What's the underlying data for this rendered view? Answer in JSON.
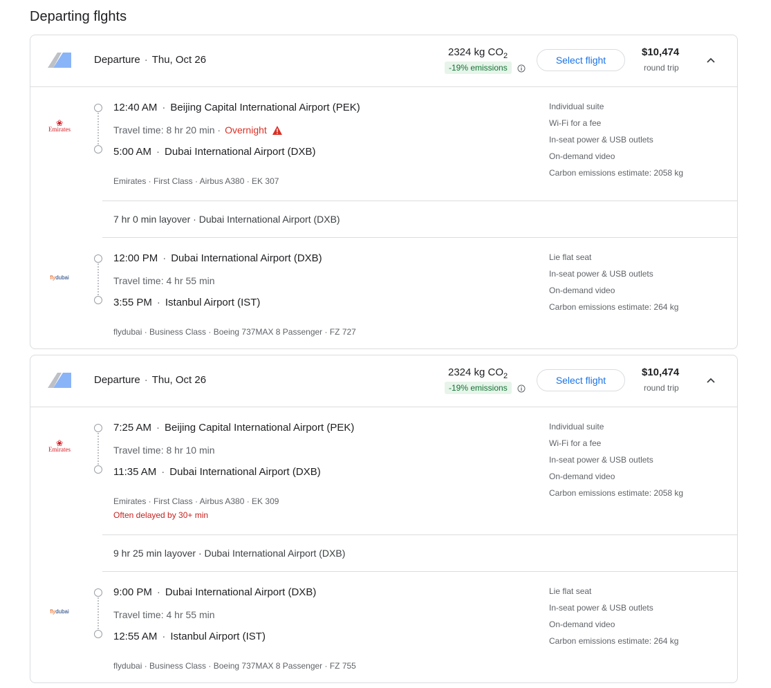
{
  "page_title": "Departing flghts",
  "colors": {
    "accent": "#1a73e8",
    "emissions_bg": "#e6f4ea",
    "emissions_text": "#137333",
    "warning": "#d93025",
    "border": "#dadce0"
  },
  "flights": [
    {
      "header": {
        "label": "Departure",
        "date": "Thu, Oct 26",
        "co2_value": "2324 kg CO",
        "co2_sub": "2",
        "emissions": "-19% emissions",
        "select_label": "Select flight",
        "price": "$10,474",
        "price_sub": "round trip"
      },
      "segments": [
        {
          "airline_logo": "Emirates",
          "dep_time": "12:40 AM",
          "dep_airport": "Beijing Capital International Airport (PEK)",
          "travel_time": "Travel time: 8 hr 20 min",
          "overnight": "Overnight",
          "arr_time": "5:00 AM",
          "arr_airport": "Dubai International Airport (DXB)",
          "details": "Emirates · First Class · Airbus A380 · EK 307",
          "delay": "",
          "amenities": [
            "Individual suite",
            "Wi-Fi for a fee",
            "In-seat power & USB outlets",
            "On-demand video",
            "Carbon emissions estimate: 2058 kg"
          ]
        },
        {
          "airline_logo": "flydubai",
          "dep_time": "12:00 PM",
          "dep_airport": "Dubai International Airport (DXB)",
          "travel_time": "Travel time: 4 hr 55 min",
          "overnight": "",
          "arr_time": "3:55 PM",
          "arr_airport": "Istanbul Airport (IST)",
          "details": "flydubai · Business Class · Boeing 737MAX 8 Passenger · FZ 727",
          "delay": "",
          "amenities": [
            "Lie flat seat",
            "In-seat power & USB outlets",
            "On-demand video",
            "Carbon emissions estimate: 264 kg"
          ]
        }
      ],
      "layover": "7 hr 0 min layover · Dubai International Airport (DXB)"
    },
    {
      "header": {
        "label": "Departure",
        "date": "Thu, Oct 26",
        "co2_value": "2324 kg CO",
        "co2_sub": "2",
        "emissions": "-19% emissions",
        "select_label": "Select flight",
        "price": "$10,474",
        "price_sub": "round trip"
      },
      "segments": [
        {
          "airline_logo": "Emirates",
          "dep_time": "7:25 AM",
          "dep_airport": "Beijing Capital International Airport (PEK)",
          "travel_time": "Travel time: 8 hr 10 min",
          "overnight": "",
          "arr_time": "11:35 AM",
          "arr_airport": "Dubai International Airport (DXB)",
          "details": "Emirates · First Class · Airbus A380 · EK 309",
          "delay": "Often delayed by 30+ min",
          "amenities": [
            "Individual suite",
            "Wi-Fi for a fee",
            "In-seat power & USB outlets",
            "On-demand video",
            "Carbon emissions estimate: 2058 kg"
          ]
        },
        {
          "airline_logo": "flydubai",
          "dep_time": "9:00 PM",
          "dep_airport": "Dubai International Airport (DXB)",
          "travel_time": "Travel time: 4 hr 55 min",
          "overnight": "",
          "arr_time": "12:55 AM",
          "arr_airport": "Istanbul Airport (IST)",
          "details": "flydubai · Business Class · Boeing 737MAX 8 Passenger · FZ 755",
          "delay": "",
          "amenities": [
            "Lie flat seat",
            "In-seat power & USB outlets",
            "On-demand video",
            "Carbon emissions estimate: 264 kg"
          ]
        }
      ],
      "layover": "9 hr 25 min layover · Dubai International Airport (DXB)"
    }
  ]
}
